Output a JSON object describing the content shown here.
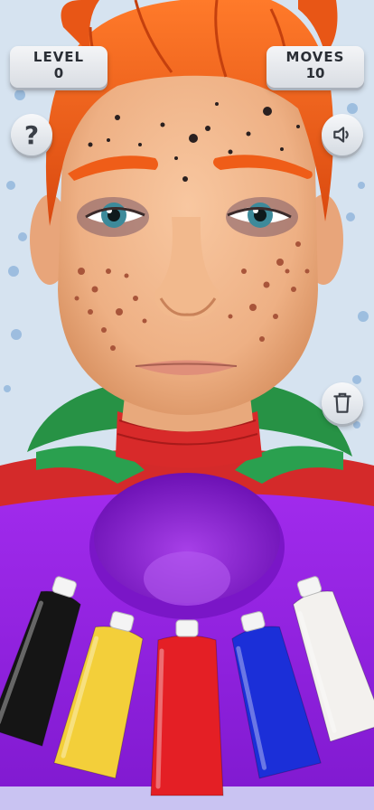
{
  "hud": {
    "level_label": "LEVEL",
    "level_value": "0",
    "moves_label": "MOVES",
    "moves_value": "10"
  },
  "buttons": {
    "help_symbol": "?",
    "sound_icon": "speaker-icon",
    "trash_icon": "trash-icon"
  },
  "paint_tubes": [
    {
      "color": "#151515",
      "name": "black"
    },
    {
      "color": "#f3cf3a",
      "name": "yellow"
    },
    {
      "color": "#e41f25",
      "name": "red"
    },
    {
      "color": "#1b2fd8",
      "name": "blue"
    },
    {
      "color": "#f3f1ee",
      "name": "white"
    }
  ],
  "colors": {
    "hair": "#f2621d",
    "skin": "#f0b88d",
    "shirt": "#9a22e6",
    "hood": "#279245"
  }
}
